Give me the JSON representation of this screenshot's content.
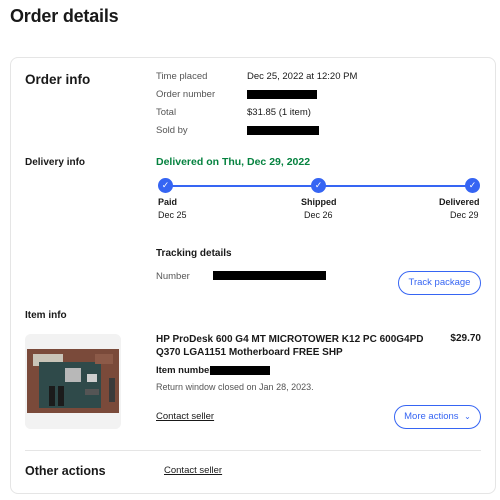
{
  "page": {
    "title": "Order details"
  },
  "order_info": {
    "heading": "Order info",
    "rows": [
      {
        "label": "Time placed",
        "value": "Dec 25, 2022 at 12:20 PM"
      },
      {
        "label": "Order number",
        "value": ""
      },
      {
        "label": "Total",
        "value": "$31.85 (1 item)"
      },
      {
        "label": "Sold by",
        "value": ""
      }
    ]
  },
  "delivery_info": {
    "heading": "Delivery info",
    "status": "Delivered on Thu, Dec 29, 2022",
    "steps": [
      {
        "label": "Paid",
        "date": "Dec 25"
      },
      {
        "label": "Shipped",
        "date": "Dec 26"
      },
      {
        "label": "Delivered",
        "date": "Dec 29"
      }
    ],
    "tracking_heading": "Tracking details",
    "tracking_number_label": "Number",
    "track_button": "Track package"
  },
  "item_info": {
    "heading": "Item info",
    "title": "HP ProDesk 600 G4 MT MICROTOWER K12 PC 600G4PD Q370 LGA1151 Motherboard FREE SHP",
    "price": "$29.70",
    "item_number_label": "Item number:",
    "return_text": "Return window closed on Jan 28, 2023.",
    "contact_seller": "Contact seller",
    "more_actions": "More actions"
  },
  "other_actions": {
    "heading": "Other actions",
    "contact_seller": "Contact seller"
  },
  "colors": {
    "accent": "#3665f3",
    "delivered_green": "#05823f"
  }
}
